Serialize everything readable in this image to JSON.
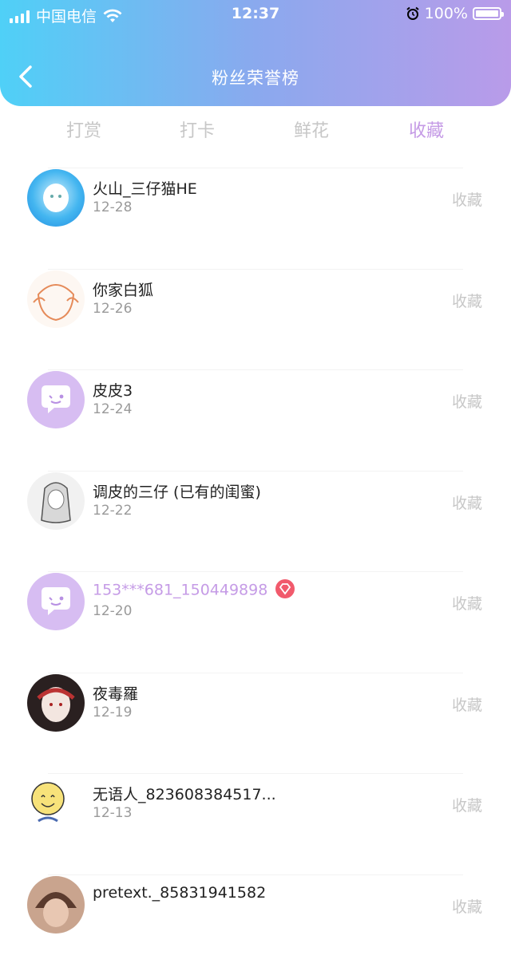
{
  "status_bar": {
    "carrier": "中国电信",
    "time": "12:37",
    "battery_percent": "100%",
    "battery_level": 1.0
  },
  "header": {
    "title": "粉丝荣誉榜",
    "back_icon": "chevron-left-icon"
  },
  "tabs": [
    {
      "label": "打赏",
      "active": false
    },
    {
      "label": "打卡",
      "active": false
    },
    {
      "label": "鲜花",
      "active": false
    },
    {
      "label": "收藏",
      "active": true
    }
  ],
  "list": [
    {
      "name": "火山_三仔猫HE",
      "date": "12-28",
      "action": "收藏"
    },
    {
      "name": "你家白狐",
      "date": "12-26",
      "action": "收藏"
    },
    {
      "name": "皮皮3",
      "date": "12-24",
      "action": "收藏"
    },
    {
      "name": "调皮的三仔 (已有的闺蜜)",
      "date": "12-22",
      "action": "收藏"
    },
    {
      "name": "153***681_150449898",
      "date": "12-20",
      "action": "收藏",
      "vip": true
    },
    {
      "name": "夜毒羅",
      "date": "12-19",
      "action": "收藏"
    },
    {
      "name": "无语人_823608384517...",
      "date": "12-13",
      "action": "收藏"
    },
    {
      "name": "pretext._85831941582",
      "date": "",
      "action": "收藏"
    }
  ],
  "colors": {
    "accent": "#c59be6",
    "header_start": "#4fd0f7",
    "header_end": "#b99be9",
    "vip_badge": "#f15a6c"
  }
}
